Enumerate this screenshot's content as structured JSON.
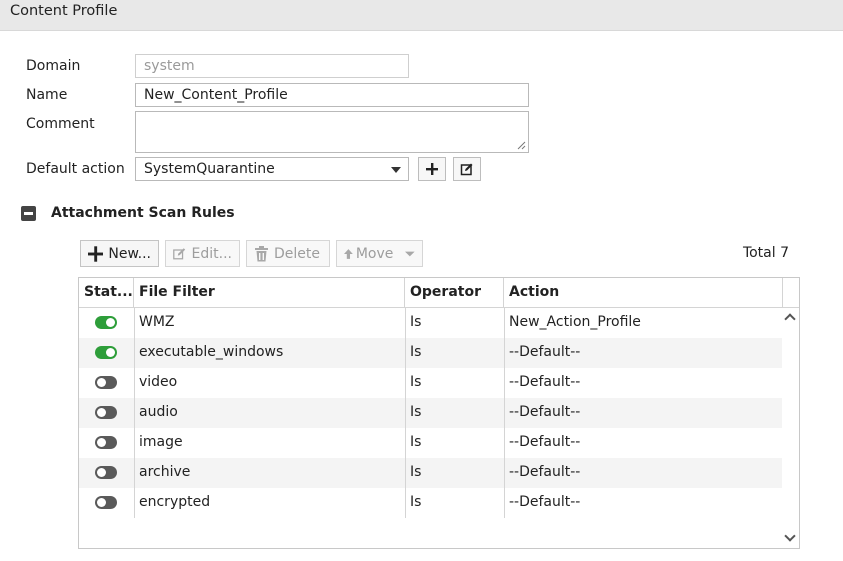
{
  "window": {
    "title": "Content Profile"
  },
  "form": {
    "domain_label": "Domain",
    "domain_value": "system",
    "name_label": "Name",
    "name_value": "New_Content_Profile",
    "comment_label": "Comment",
    "comment_value": "",
    "default_action_label": "Default action",
    "default_action_value": "SystemQuarantine"
  },
  "section": {
    "title": "Attachment Scan Rules",
    "state": "expanded"
  },
  "toolbar": {
    "new_label": "New...",
    "edit_label": "Edit...",
    "delete_label": "Delete",
    "move_label": "Move",
    "total_label": "Total 7"
  },
  "table": {
    "columns": [
      "Stat...",
      "File Filter",
      "Operator",
      "Action"
    ],
    "rows": [
      {
        "status": "on",
        "file_filter": "WMZ",
        "operator": "Is",
        "action": "New_Action_Profile"
      },
      {
        "status": "on",
        "file_filter": "executable_windows",
        "operator": "Is",
        "action": "--Default--"
      },
      {
        "status": "off",
        "file_filter": "video",
        "operator": "Is",
        "action": "--Default--"
      },
      {
        "status": "off",
        "file_filter": "audio",
        "operator": "Is",
        "action": "--Default--"
      },
      {
        "status": "off",
        "file_filter": "image",
        "operator": "Is",
        "action": "--Default--"
      },
      {
        "status": "off",
        "file_filter": "archive",
        "operator": "Is",
        "action": "--Default--"
      },
      {
        "status": "off",
        "file_filter": "encrypted",
        "operator": "Is",
        "action": "--Default--"
      }
    ]
  },
  "colors": {
    "toggle_on": "#2e9e3a",
    "toggle_off": "#5a5a5a",
    "title_bar": "#e8e8e8"
  },
  "icons": [
    "plus-icon",
    "edit-icon",
    "pencil-icon",
    "trash-icon",
    "arrow-up-icon",
    "caret-down-icon",
    "collapse-icon",
    "resize-grip-icon"
  ]
}
